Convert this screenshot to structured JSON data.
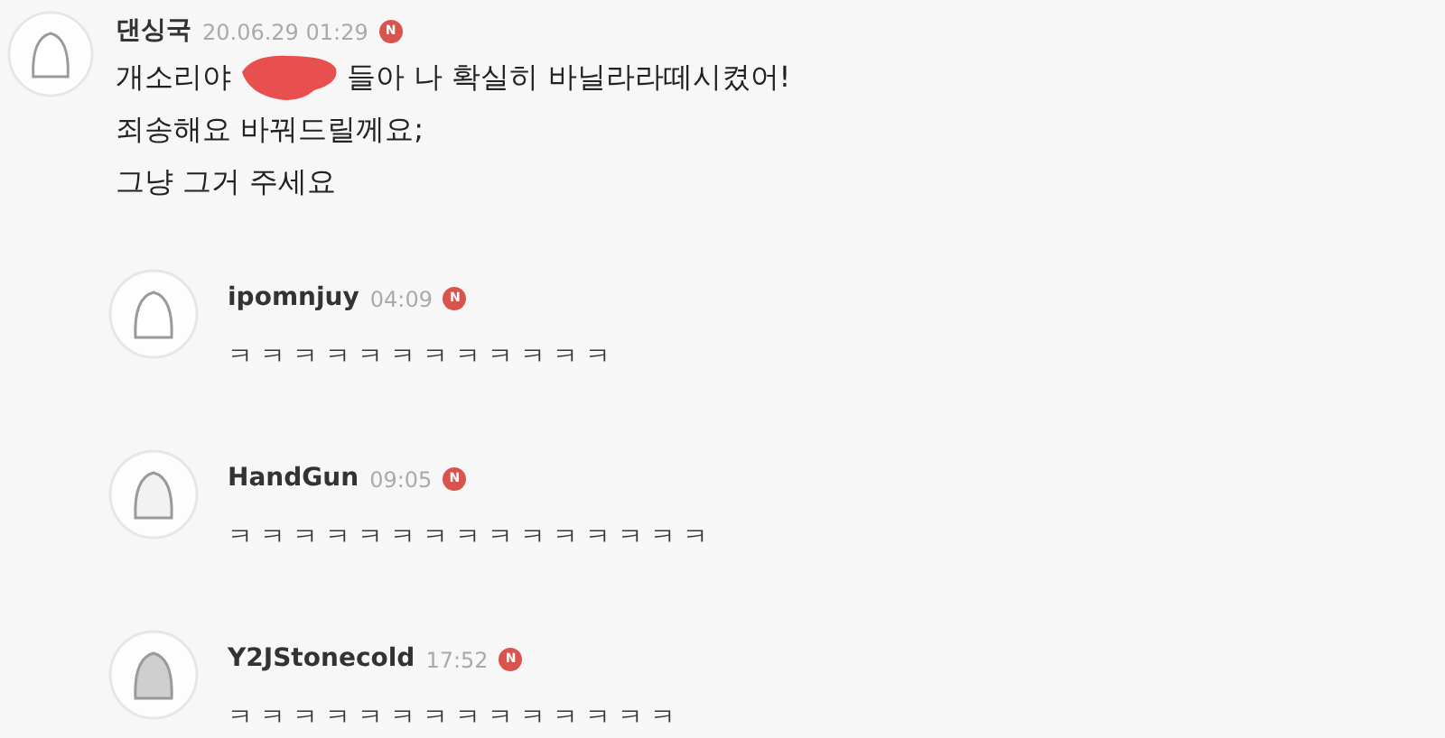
{
  "comment": {
    "author": "댄싱국",
    "time": "20.06.29 01:29",
    "badge": "N",
    "lines": [
      {
        "kind": "redacted",
        "before": "개소리야",
        "after": "들아 나 확실히 바닐라라떼시켰어!"
      },
      {
        "kind": "plain",
        "text": "죄송해요 바꿔드릴께요;"
      },
      {
        "kind": "plain",
        "text": "그냥 그거 주세요"
      }
    ]
  },
  "replies": [
    {
      "author": "ipomnjuy",
      "time": "04:09",
      "badge": "N",
      "text": "ㅋㅋㅋㅋㅋㅋㅋㅋㅋㅋㅋㅋ"
    },
    {
      "author": "HandGun",
      "time": "09:05",
      "badge": "N",
      "text": "ㅋㅋㅋㅋㅋㅋㅋㅋㅋㅋㅋㅋㅋㅋㅋ"
    },
    {
      "author": "Y2JStonecold",
      "time": "17:52",
      "badge": "N",
      "text": "ㅋㅋㅋㅋㅋㅋㅋㅋㅋㅋㅋㅋㅋㅋ"
    }
  ]
}
